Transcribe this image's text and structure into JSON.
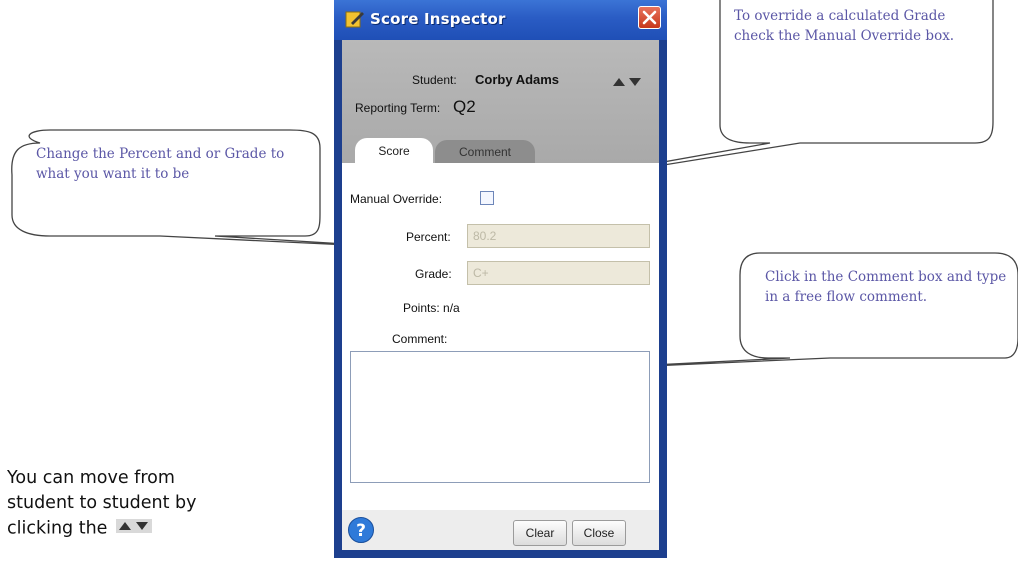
{
  "window": {
    "title": "Score Inspector",
    "student_label": "Student:",
    "student_name": "Corby Adams",
    "term_label": "Reporting Term:",
    "term_value": "Q2",
    "tabs": [
      {
        "label": "Score"
      },
      {
        "label": "Comment"
      }
    ],
    "manual_override_label": "Manual Override:",
    "percent_label": "Percent:",
    "percent_value": "80.2",
    "grade_label": "Grade:",
    "grade_value": "C+",
    "points_label": "Points: n/a",
    "comment_label": "Comment:",
    "comment_value": "",
    "buttons": {
      "clear": "Clear",
      "close": "Close"
    }
  },
  "callouts": {
    "top_right": "To override a calculated Grade check the Manual Override box.",
    "left": "Change the Percent and or Grade to what you want it to be",
    "right": "Click in the Comment box and type in a free flow comment."
  },
  "note": {
    "text": "You can move from student to student by clicking the"
  },
  "icons": {
    "title": "pencil-icon",
    "close": "close-icon",
    "nav": "up-down-arrows-icon",
    "help": "help-icon"
  },
  "colors": {
    "window_border": "#1d3f8e",
    "titlebar": "#2a5cc4",
    "callout_text": "#5b57a6"
  }
}
